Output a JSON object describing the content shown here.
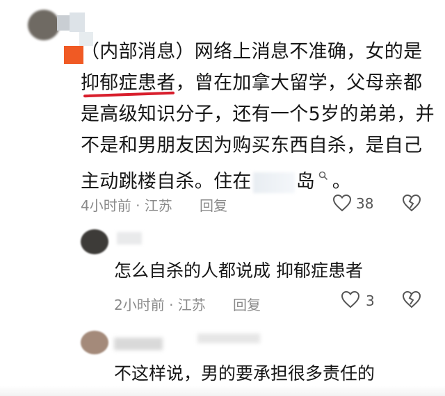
{
  "comments": [
    {
      "lines": [
        "（内部消息）网络上消息不准确，女的是",
        "抑郁症患者",
        "，曾在加拿大留学，父母亲都",
        "是高级知识分子，还有一个5岁的弟弟，并",
        "不是和男朋友因为购买东西自杀，是自己",
        "主动跳楼自杀。住在",
        "岛"
      ],
      "meta": "4小时前 · 江苏",
      "reply": "回复",
      "likes": "38"
    },
    {
      "text": "怎么自杀的人都说成 抑郁症患者",
      "meta": "2小时前 · 江苏",
      "reply": "回复",
      "likes": "3"
    },
    {
      "text": "不这样说，男的要承担很多责任的"
    }
  ],
  "colors": {
    "highlight": "#d81e2c",
    "meta": "#8a8a8a"
  },
  "icons": [
    "heart-icon",
    "heartbreak-icon",
    "search-icon"
  ]
}
